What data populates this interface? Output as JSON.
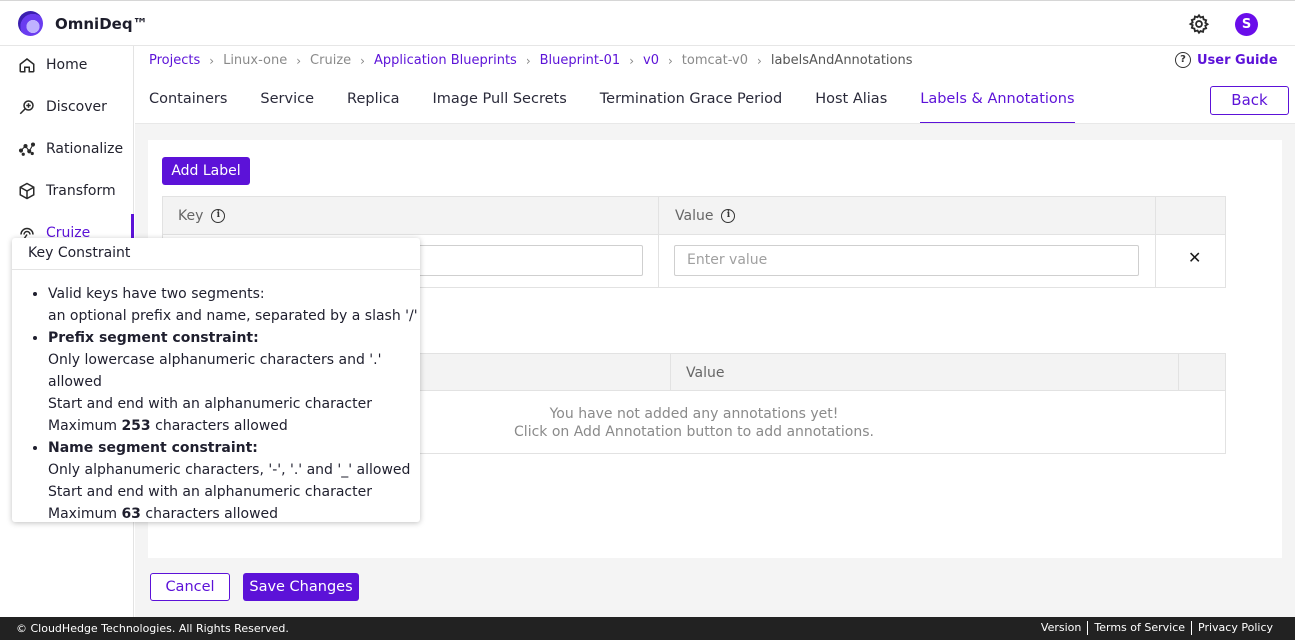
{
  "app": {
    "brand": "OmniDeq™",
    "avatar_initial": "S",
    "accent_color": "#5c12d8"
  },
  "sidebar": {
    "items": [
      {
        "label": "Home",
        "icon": "home-icon"
      },
      {
        "label": "Discover",
        "icon": "discover-icon"
      },
      {
        "label": "Rationalize",
        "icon": "rationalize-icon"
      },
      {
        "label": "Transform",
        "icon": "transform-icon"
      },
      {
        "label": "Cruize",
        "icon": "cruize-icon",
        "active": true
      }
    ]
  },
  "breadcrumb": {
    "items": [
      "Projects",
      "Linux-one",
      "Cruize",
      "Application Blueprints",
      "Blueprint-01",
      "v0",
      "tomcat-v0",
      "labelsAndAnnotations"
    ],
    "separator": "›"
  },
  "user_guide": {
    "label": "User Guide",
    "icon_glyph": "?"
  },
  "tabs": {
    "items": [
      "Containers",
      "Service",
      "Replica",
      "Image Pull Secrets",
      "Termination Grace Period",
      "Host Alias",
      "Labels & Annotations"
    ],
    "active": "Labels & Annotations"
  },
  "back_button": "Back",
  "labels": {
    "add_button": "Add Label",
    "columns": {
      "key": "Key",
      "value": "Value"
    },
    "row": {
      "value_placeholder": "Enter value",
      "delete_glyph": "✕"
    }
  },
  "annotations": {
    "columns": {
      "value": "Value"
    },
    "empty_line1": "You have not added any annotations yet!",
    "empty_line2": "Click on Add Annotation button to add annotations."
  },
  "tooltip": {
    "title": "Key Constraint",
    "b1_line1": "Valid keys have two segments:",
    "b1_line2": "an optional prefix and name, separated by a slash '/'",
    "b2_title": "Prefix segment constraint:",
    "b2_line1": "Only lowercase alphanumeric characters and '.' allowed",
    "b2_line2": "Start and end with an alphanumeric character",
    "b2_max_prefix": "Maximum ",
    "b2_max_num": "253",
    "b2_max_suffix": " characters allowed",
    "b3_title": "Name segment constraint:",
    "b3_line1": "Only alphanumeric characters, '-', '.' and '_' allowed",
    "b3_line2": "Start and end with an alphanumeric character",
    "b3_max_prefix": "Maximum ",
    "b3_max_num": "63",
    "b3_max_suffix": " characters allowed"
  },
  "actions": {
    "cancel": "Cancel",
    "save": "Save Changes"
  },
  "footer": {
    "copyright": "© CloudHedge Technologies. All Rights Reserved.",
    "links": [
      "Version",
      "Terms of Service",
      "Privacy Policy"
    ]
  }
}
